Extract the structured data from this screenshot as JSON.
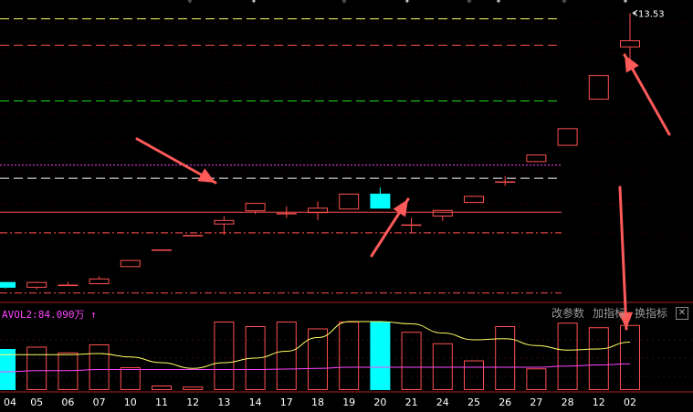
{
  "chart_data": {
    "type": "candlestick",
    "categories": [
      "04",
      "05",
      "06",
      "07",
      "10",
      "11",
      "12",
      "13",
      "14",
      "17",
      "18",
      "19",
      "20",
      "21",
      "24",
      "25",
      "26",
      "27",
      "28",
      "12",
      "02"
    ],
    "candles": [
      {
        "date": "04",
        "open": 7.28,
        "close": 7.41,
        "high": 7.41,
        "low": 7.26,
        "color": "cyan"
      },
      {
        "date": "05",
        "open": 7.28,
        "close": 7.41,
        "high": 7.42,
        "low": 7.24,
        "color": "red"
      },
      {
        "date": "06",
        "open": 7.33,
        "close": 7.35,
        "high": 7.41,
        "low": 7.33,
        "color": "red"
      },
      {
        "date": "07",
        "open": 7.36,
        "close": 7.49,
        "high": 7.54,
        "low": 7.36,
        "color": "red"
      },
      {
        "date": "10",
        "open": 7.75,
        "close": 7.91,
        "high": 7.91,
        "low": 7.75,
        "color": "red"
      },
      {
        "date": "11",
        "open": 8.13,
        "close": 8.15,
        "high": 8.15,
        "low": 8.13,
        "color": "red"
      },
      {
        "date": "12",
        "open": 8.47,
        "close": 8.48,
        "high": 8.48,
        "low": 8.47,
        "color": "red"
      },
      {
        "date": "13",
        "open": 8.72,
        "close": 8.82,
        "high": 8.91,
        "low": 8.49,
        "color": "red"
      },
      {
        "date": "14",
        "open": 9.02,
        "close": 9.21,
        "high": 9.21,
        "low": 8.96,
        "color": "red"
      },
      {
        "date": "17",
        "open": 8.97,
        "close": 8.98,
        "high": 9.13,
        "low": 8.87,
        "color": "red"
      },
      {
        "date": "18",
        "open": 8.98,
        "close": 9.1,
        "high": 9.24,
        "low": 8.82,
        "color": "red"
      },
      {
        "date": "19",
        "open": 9.06,
        "close": 9.42,
        "high": 9.42,
        "low": 9.06,
        "color": "red"
      },
      {
        "date": "20",
        "open": 9.42,
        "close": 9.08,
        "high": 9.56,
        "low": 9.08,
        "color": "cyan"
      },
      {
        "date": "21",
        "open": 8.7,
        "close": 8.72,
        "high": 8.87,
        "low": 8.54,
        "color": "red"
      },
      {
        "date": "24",
        "open": 8.9,
        "close": 9.05,
        "high": 9.05,
        "low": 8.8,
        "color": "red"
      },
      {
        "date": "25",
        "open": 9.21,
        "close": 9.37,
        "high": 9.37,
        "low": 9.21,
        "color": "red"
      },
      {
        "date": "26",
        "open": 9.67,
        "close": 9.7,
        "high": 9.82,
        "low": 9.6,
        "color": "red"
      },
      {
        "date": "27",
        "open": 10.14,
        "close": 10.31,
        "high": 10.31,
        "low": 10.14,
        "color": "red"
      },
      {
        "date": "28",
        "open": 10.51,
        "close": 10.91,
        "high": 10.91,
        "low": 10.51,
        "color": "red"
      },
      {
        "date": "12",
        "open": 11.56,
        "close": 12.12,
        "high": 12.12,
        "low": 11.56,
        "color": "red"
      },
      {
        "date": "02",
        "open": 12.75,
        "close": 12.91,
        "high": 13.53,
        "low": 12.44,
        "color": "red"
      }
    ],
    "high_label": "13.53",
    "ylim": [
      7.05,
      13.62
    ],
    "hlines": [
      {
        "value": 13.4,
        "color": "#ffff66",
        "style": "dashed"
      },
      {
        "value": 12.8,
        "color": "#ff5050",
        "style": "dashed"
      },
      {
        "value": 11.53,
        "color": "#22dd22",
        "style": "dashed"
      },
      {
        "value": 10.07,
        "color": "#ff44ff",
        "style": "dotted"
      },
      {
        "value": 9.77,
        "color": "#ffffff",
        "style": "dashed"
      },
      {
        "value": 9.0,
        "color": "#ff5050",
        "style": "solid"
      },
      {
        "value": 8.53,
        "color": "#ff5050",
        "style": "dashdot"
      },
      {
        "value": 7.16,
        "color": "#ff5050",
        "style": "dashdot"
      }
    ],
    "volume": {
      "indicator_label": "AVOL2:84.090万 ↑",
      "ylim": [
        0,
        3.0
      ],
      "bars": [
        1.8,
        1.9,
        1.65,
        2.0,
        1.0,
        0.2,
        0.15,
        3.0,
        2.8,
        3.0,
        2.7,
        3.0,
        3.0,
        2.55,
        2.05,
        1.3,
        2.8,
        0.95,
        2.95,
        2.75,
        2.85
      ],
      "ma_yellow": [
        1.55,
        1.55,
        1.55,
        1.6,
        1.45,
        1.2,
        0.95,
        1.2,
        1.4,
        1.7,
        2.3,
        3.0,
        3.0,
        2.9,
        2.5,
        2.2,
        2.25,
        1.95,
        1.75,
        1.8,
        2.1
      ],
      "ma_magenta": [
        0.8,
        0.85,
        0.85,
        0.9,
        0.9,
        0.9,
        0.9,
        0.9,
        0.9,
        0.92,
        0.95,
        1.0,
        1.0,
        1.0,
        1.0,
        1.0,
        1.0,
        1.0,
        1.05,
        1.1,
        1.15
      ]
    }
  },
  "toolbar": {
    "modify_params": "改参数",
    "add_indicator": "加指标",
    "switch_indicator": "换指标",
    "close_glyph": "✕"
  },
  "colors": {
    "up": "#ff5050",
    "down": "#00ffff",
    "vol_ma_yellow": "#ffff66",
    "vol_ma_magenta": "#ff44ff",
    "axis_text": "#ffffff",
    "frame": "#aa2222",
    "arrow": "#ff5a5a"
  }
}
